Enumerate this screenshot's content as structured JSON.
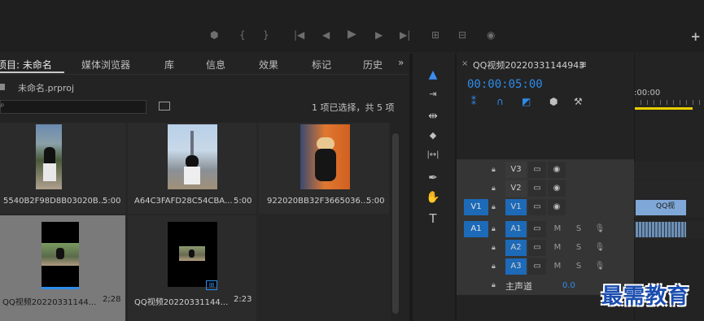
{
  "transport": {
    "icons": [
      "marker-icon",
      "mark-in-icon",
      "mark-out-icon",
      "go-to-in-icon",
      "step-back-icon",
      "play-icon",
      "step-forward-icon",
      "go-to-out-icon",
      "insert-icon",
      "overwrite-icon",
      "export-frame-icon"
    ],
    "plus": "+"
  },
  "project": {
    "tabs": [
      {
        "label": "项目: 未命名"
      },
      {
        "label": "媒体浏览器"
      },
      {
        "label": "库"
      },
      {
        "label": "信息"
      },
      {
        "label": "效果"
      },
      {
        "label": "标记"
      },
      {
        "label": "历史"
      }
    ],
    "more": "»",
    "file_name": "未命名.prproj",
    "search_placeholder": "",
    "status": "1 项已选择，共 5 项",
    "clips": [
      {
        "name": "5540B2F98D8B03020B...",
        "duration": "5:00",
        "selected": false,
        "accent": "#7fa8d8"
      },
      {
        "name": "A64C3FAFD28C54CBA...",
        "duration": "5:00",
        "selected": false,
        "accent": "#c0d0e0"
      },
      {
        "name": "922020BB32F3665036...",
        "duration": "5:00",
        "selected": false,
        "accent": "#e07830"
      },
      {
        "name": "QQ视频20220331144...",
        "duration": "2;28",
        "selected": true,
        "accent": "#2d8ceb"
      },
      {
        "name": "QQ视频20220331144...",
        "duration": "2:23",
        "selected": false,
        "accent": "#2d8ceb"
      }
    ]
  },
  "tools": [
    {
      "name": "selection-tool",
      "glyph": "▲",
      "active": true
    },
    {
      "name": "track-select-tool",
      "glyph": "⇥",
      "active": false
    },
    {
      "name": "ripple-edit-tool",
      "glyph": "⇹",
      "active": false
    },
    {
      "name": "razor-tool",
      "glyph": "◆",
      "active": false
    },
    {
      "name": "slip-tool",
      "glyph": "|↔|",
      "active": false
    },
    {
      "name": "pen-tool",
      "glyph": "✒",
      "active": false
    },
    {
      "name": "hand-tool",
      "glyph": "✋",
      "active": false
    },
    {
      "name": "type-tool",
      "glyph": "T",
      "active": false
    }
  ],
  "timeline": {
    "close": "×",
    "title": "QQ视频20220331144943",
    "menu": "≡",
    "timecode": "00:00:05:00",
    "ruler_label": ":00:00",
    "tracks": {
      "video": [
        {
          "source": "",
          "name": "V3",
          "highlight": false
        },
        {
          "source": "",
          "name": "V2",
          "highlight": false
        },
        {
          "source": "V1",
          "name": "V1",
          "highlight": true
        }
      ],
      "audio": [
        {
          "source": "A1",
          "name": "A1",
          "highlight": true
        },
        {
          "source": "",
          "name": "A2",
          "highlight": true
        },
        {
          "source": "",
          "name": "A3",
          "highlight": true
        }
      ],
      "m_label": "M",
      "s_label": "S"
    },
    "master": {
      "label": "主声道",
      "value": "0.0"
    },
    "video_clip_label": "QQ视"
  },
  "watermark": "最需教育"
}
